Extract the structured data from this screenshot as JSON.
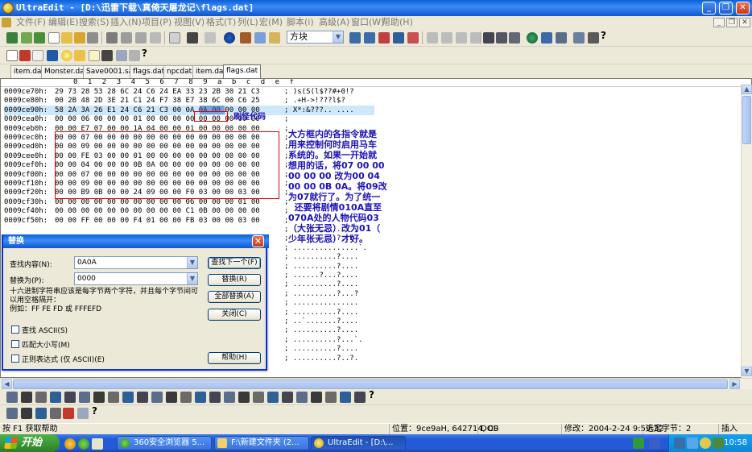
{
  "window": {
    "title": "UltraEdit - [D:\\迅雷下载\\真倚天屠龙记\\flags.dat]",
    "min_label": "_",
    "restore_label": "❐",
    "close_label": "✕"
  },
  "menu": [
    "文件(F)",
    "编辑(E)",
    "搜索(S)",
    "插入(N)",
    "项目(P)",
    "视图(V)",
    "格式(T)",
    "列(L)",
    "宏(M)",
    "脚本(i)",
    "高级(A)",
    "窗口(W)",
    "帮助(H)"
  ],
  "mdi_buttons": [
    "_",
    "❐",
    "✕"
  ],
  "toolbar": {
    "font_combo_value": "方块"
  },
  "tabs": [
    {
      "label": "item.dat",
      "active": false
    },
    {
      "label": "Monster.dat",
      "active": false
    },
    {
      "label": "Save0001.sav",
      "active": false
    },
    {
      "label": "flags.dat",
      "active": false
    },
    {
      "label": "npcdata",
      "active": false
    },
    {
      "label": "item.dat",
      "active": false
    },
    {
      "label": "flags.dat",
      "active": true
    }
  ],
  "ruler": [
    "0",
    "1",
    "2",
    "3",
    "4",
    "5",
    "6",
    "7",
    "8",
    "9",
    "a",
    "b",
    "c",
    "d",
    "e",
    "f"
  ],
  "hex_rows": [
    {
      "addr": "0009ce70h:",
      "bytes": "29 73 28 53 28 6C 24 C6 24 EA 33 23 2B 30 21 C3",
      "ascii": "; )s(S(l$??#+0!?"
    },
    {
      "addr": "0009ce80h:",
      "bytes": "00 2B 48 2D 3E 21 C1 24 F7 38 E7 38 6C 00 C6 25",
      "ascii": "; .+H->!???l$?"
    },
    {
      "addr": "0009ce90h:",
      "bytes": "58 2A 3A 26 E1 24 C6 21 C3 00 0A 0A 00 00 00 00",
      "ascii": "; X*:&???.. ...."
    },
    {
      "addr": "0009cea0h:",
      "bytes": "00 00 06 00 00 00 01 00 00 00 00 00 00 00 00 00",
      "ascii": ";"
    },
    {
      "addr": "0009ceb0h:",
      "bytes": "00 00 E7 07 00 00 1A 04 00 00 01 00 00 00 00 00",
      "ascii": ";"
    },
    {
      "addr": "0009cec0h:",
      "bytes": "00 00 07 00 00 00 00 00 00 00 00 00 00 00 00 00",
      "ascii": ";"
    },
    {
      "addr": "0009ced0h:",
      "bytes": "00 00 09 00 00 00 00 00 00 00 00 00 00 00 00 00",
      "ascii": ";"
    },
    {
      "addr": "0009cee0h:",
      "bytes": "00 00 FE 03 00 00 01 00 00 00 00 00 00 00 00 00",
      "ascii": ";"
    },
    {
      "addr": "0009cef0h:",
      "bytes": "00 00 04 00 00 00 0B 0A 00 00 00 00 00 00 00 00",
      "ascii": ";"
    },
    {
      "addr": "0009cf00h:",
      "bytes": "00 00 07 00 00 00 00 00 00 00 00 00 00 00 00 00",
      "ascii": ";"
    },
    {
      "addr": "0009cf10h:",
      "bytes": "00 00 09 00 00 00 00 00 00 00 00 00 00 00 00 00",
      "ascii": ";"
    },
    {
      "addr": "0009cf20h:",
      "bytes": "00 00 B9 0B 00 00 24 09 00 00 F0 03 00 00 03 00",
      "ascii": ";"
    },
    {
      "addr": "0009cf30h:",
      "bytes": "00 00 00 00 00 00 00 00 00 00 06 00 00 00 01 00",
      "ascii": ";"
    },
    {
      "addr": "0009cf40h:",
      "bytes": "00 00 00 00 00 00 00 00 00 00 C1 0B 00 00 00 00",
      "ascii": ";"
    },
    {
      "addr": "0009cf50h:",
      "bytes": "00 00 FF 00 00 00 F4 01 00 00 FB 03 00 00 03 00",
      "ascii": ";"
    }
  ],
  "hidden_rows_ascii": [
    "; ....,........ .",
    "; ..........?..b.",
    "; ...............`.",
    "; ..........?....",
    "; ..........?....",
    "; ......?...?....",
    "; ..........?....",
    "; ..........?...?",
    "; ...............",
    "; ..........?....",
    "; ..`.......?....",
    "; ..........?....",
    "; ..........?...`.",
    "; ..........?....",
    "; ..........?..?."
  ],
  "annotation": {
    "label": "刷怪代码",
    "note": "大方框内的各指令就是\n用来控制何时启用马车\n系统的。如果一开始就\n想用的话，将07 00 00\n00 00 00 改为00 04\n00 00 0B 0A。将09改\n为07就行了。为了统一\n  还要将剧情010A直至\n070A处的人物代码03\n（大张无忌）改为01（\n少年张无忌）才好。"
  },
  "dialog": {
    "title": "替换",
    "find_label": "查找内容(N):",
    "find_value": "0A0A",
    "replace_label": "替换为(P):",
    "replace_value": "0000",
    "hint": "十六进制字符串应该是每字节两个字符，并且每个字节间可\n以用空格隔开：\n例如：FF FE FD 或 FFFEFD",
    "buttons": [
      "查找下一个(F)",
      "替换(R)",
      "全部替换(A)",
      "关闭(C)",
      "帮助(H)"
    ],
    "checkboxes": [
      "查找 ASCII(S)",
      "匹配大小写(M)",
      "正则表达式 (仅 ASCII)(E)"
    ]
  },
  "status": {
    "help": "按 F1 获取帮助",
    "position": "位置：9ce9aH, 642714, C0",
    "format": "DOS",
    "time": "修改：2004-2-24 9:59:32",
    "selection": "选定字节：2",
    "mode": "插入"
  },
  "taskbar": {
    "start": "开始",
    "tasks": [
      {
        "label": "360安全浏览器 5...",
        "active": false
      },
      {
        "label": "F:\\新建文件夹 (2...",
        "active": false
      },
      {
        "label": "UltraEdit - [D:\\...",
        "active": true
      }
    ],
    "clock": "10:58"
  }
}
